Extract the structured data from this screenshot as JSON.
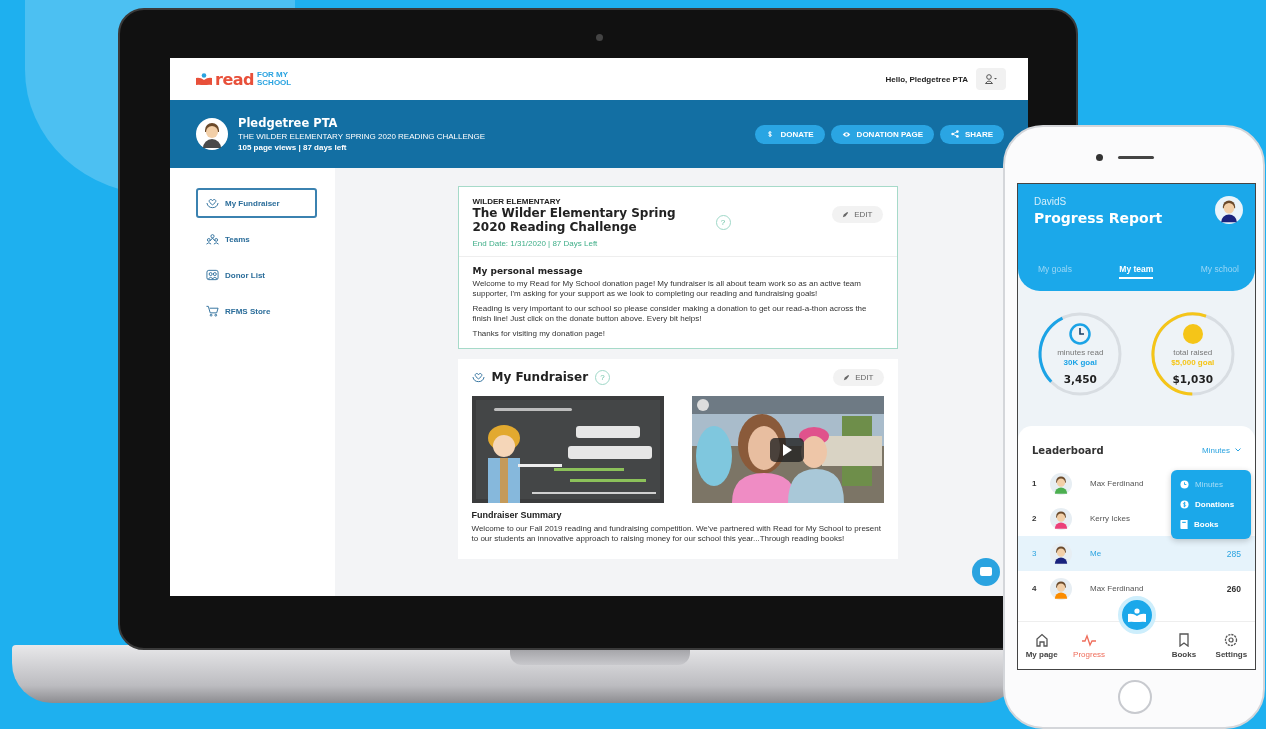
{
  "laptop": {
    "header": {
      "logo": {
        "word": "read",
        "tagline": "FOR MY SCHOOL"
      },
      "greeting": "Hello, Pledgetree PTA"
    },
    "banner": {
      "name": "Pledgetree PTA",
      "challenge": "THE WILDER ELEMENTARY SPRING 2020 READING CHALLENGE",
      "stats": "105 page views | 87 days left",
      "buttons": [
        {
          "kind": "donate",
          "label": "DONATE"
        },
        {
          "kind": "view",
          "label": "DONATION PAGE"
        },
        {
          "kind": "share",
          "label": "SHARE"
        }
      ]
    },
    "sidebar": {
      "items": [
        {
          "kind": "hands",
          "label": "My Fundraiser",
          "selected": true
        },
        {
          "kind": "team",
          "label": "Teams",
          "selected": false
        },
        {
          "kind": "donors",
          "label": "Donor List",
          "selected": false
        },
        {
          "kind": "store",
          "label": "RFMS Store",
          "selected": false
        }
      ]
    },
    "challenge_card": {
      "school": "WILDER ELEMENTARY",
      "title": "The Wilder Elementary Spring 2020 Reading Challenge",
      "help": "?",
      "edit": "EDIT",
      "dates": "End Date: 1/31/2020 | 87 Days Left",
      "message_title": "My personal message",
      "paragraphs": [
        "Welcome to my Read for My School donation page! My fundraiser is all about team work so as an active team supporter, I'm asking for your support as we look to completing our reading and fundraising goals!",
        "Reading is very important to our school so please consider making a donation to get our read-a-thon across the finish line! Just click on the donate button above. Every bit helps!",
        "Thanks for visiting my donation page!"
      ]
    },
    "fundraiser_card": {
      "title": "My Fundraiser",
      "help": "?",
      "edit": "EDIT",
      "media": [
        {
          "kind": "picture"
        },
        {
          "kind": "video"
        }
      ],
      "summary_title": "Fundraiser Summary",
      "summary": "Welcome to our Fall 2019 reading and fundraising competition. We've partnered with Read for My School to present to our students an innovative approach to raising money for our school this year...Through reading books!"
    }
  },
  "phone": {
    "user": "DavidS",
    "title": "Progress Report",
    "tabs": [
      {
        "label": "My goals",
        "selected": false
      },
      {
        "label": "My team",
        "selected": true
      },
      {
        "label": "My school",
        "selected": false
      }
    ],
    "gauges": [
      {
        "kind": "clock",
        "label": "minutes read",
        "goal": "30K goal",
        "value": "3,450",
        "level": 0.3,
        "color": "#1ba3e6"
      },
      {
        "kind": "coin",
        "label": "total raised",
        "goal": "$5,000 goal",
        "value": "$1,030",
        "level": 0.55,
        "color": "#f5c518"
      }
    ],
    "leaderboard": {
      "title": "Leaderboard",
      "sort": "Minutes",
      "menu": [
        {
          "kind": "clock",
          "label": "Minutes",
          "selected": true
        },
        {
          "kind": "dollar",
          "label": "Donations",
          "selected": false
        },
        {
          "kind": "book",
          "label": "Books",
          "selected": false
        }
      ],
      "rows": [
        {
          "rank": "1",
          "name": "Max Ferdinand",
          "selected": false
        },
        {
          "rank": "2",
          "name": "Kerry Ickes",
          "selected": false
        },
        {
          "rank": "3",
          "name": "Me",
          "score": "285",
          "selected": true
        },
        {
          "rank": "4",
          "name": "Max Ferdinand",
          "score": "260",
          "selected": false
        }
      ]
    },
    "nav": [
      {
        "kind": "home",
        "label": "My page",
        "selected": false
      },
      {
        "kind": "progress",
        "label": "Progress",
        "selected": true
      },
      {
        "kind": "center"
      },
      {
        "kind": "bookmark",
        "label": "Books",
        "selected": false
      },
      {
        "kind": "gear",
        "label": "Settings",
        "selected": false
      }
    ]
  }
}
